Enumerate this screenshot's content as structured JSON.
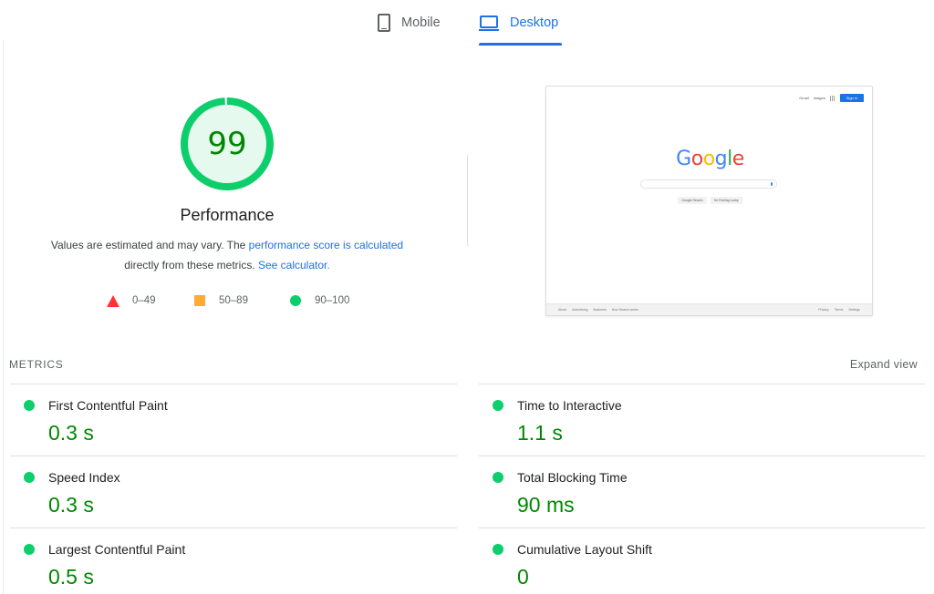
{
  "tabs": [
    {
      "label": "Mobile",
      "icon": "phone-icon",
      "active": false
    },
    {
      "label": "Desktop",
      "icon": "laptop-icon",
      "active": true
    }
  ],
  "score": {
    "value": "99",
    "fraction": 0.99,
    "color": "#008800",
    "ring_color": "#0cce6b",
    "title": "Performance",
    "desc_part1": "Values are estimated and may vary. The ",
    "desc_link1": "performance score is calculated",
    "desc_part2": "directly from these metrics. ",
    "desc_link2": "See calculator."
  },
  "legend": {
    "fail": "0–49",
    "average": "50–89",
    "pass": "90–100"
  },
  "thumbnail": {
    "top_links": [
      "Gmail",
      "Images"
    ],
    "sign_in": "Sign in",
    "logo": [
      "G",
      "o",
      "o",
      "g",
      "l",
      "e"
    ],
    "buttons": [
      "Google Search",
      "I'm Feeling Lucky"
    ],
    "footer_left": [
      "About",
      "Advertising",
      "Business",
      "How Search works"
    ],
    "footer_right": [
      "Privacy",
      "Terms",
      "Settings"
    ]
  },
  "metrics": {
    "header": "METRICS",
    "expand": "Expand view",
    "left": [
      {
        "title": "First Contentful Paint",
        "value": "0.3 s"
      },
      {
        "title": "Speed Index",
        "value": "0.3 s"
      },
      {
        "title": "Largest Contentful Paint",
        "value": "0.5 s"
      }
    ],
    "right": [
      {
        "title": "Time to Interactive",
        "value": "1.1 s"
      },
      {
        "title": "Total Blocking Time",
        "value": "90 ms"
      },
      {
        "title": "Cumulative Layout Shift",
        "value": "0"
      }
    ]
  }
}
